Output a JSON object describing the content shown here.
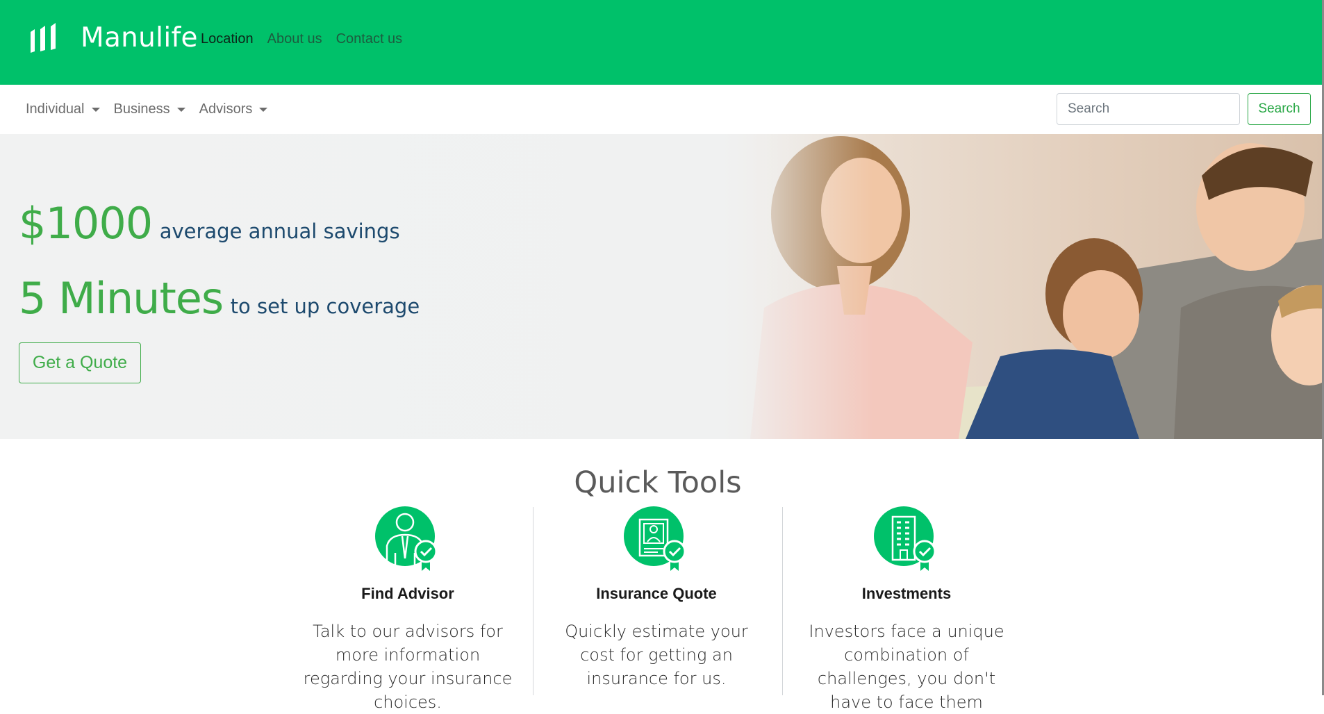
{
  "brand": {
    "name": "Manulife"
  },
  "top_nav": {
    "links": [
      {
        "label": "Location"
      },
      {
        "label": "About us"
      },
      {
        "label": "Contact us"
      }
    ]
  },
  "sub_nav": {
    "menus": [
      {
        "label": "Individual"
      },
      {
        "label": "Business"
      },
      {
        "label": "Advisors"
      }
    ],
    "search": {
      "placeholder": "Search",
      "button_label": "Search"
    }
  },
  "hero": {
    "stat1_value": "$1000",
    "stat1_text": "average annual savings",
    "stat2_value": "5 Minutes",
    "stat2_text": "to set up coverage",
    "cta_label": "Get a Quote"
  },
  "quick_tools": {
    "title": "Quick Tools",
    "items": [
      {
        "icon": "advisor-icon",
        "title": "Find Advisor",
        "text": "Talk to our advisors for more information regarding your insurance choices."
      },
      {
        "icon": "insurance-quote-icon",
        "title": "Insurance Quote",
        "text": "Quickly estimate your cost for getting an insurance for us."
      },
      {
        "icon": "investments-icon",
        "title": "Investments",
        "text": "Investors face a unique combination of challenges, you don't have to face them"
      }
    ]
  },
  "colors": {
    "brand_green": "#00c16a",
    "accent_green": "#3fac49",
    "hero_text_blue": "#1d4a6e"
  }
}
